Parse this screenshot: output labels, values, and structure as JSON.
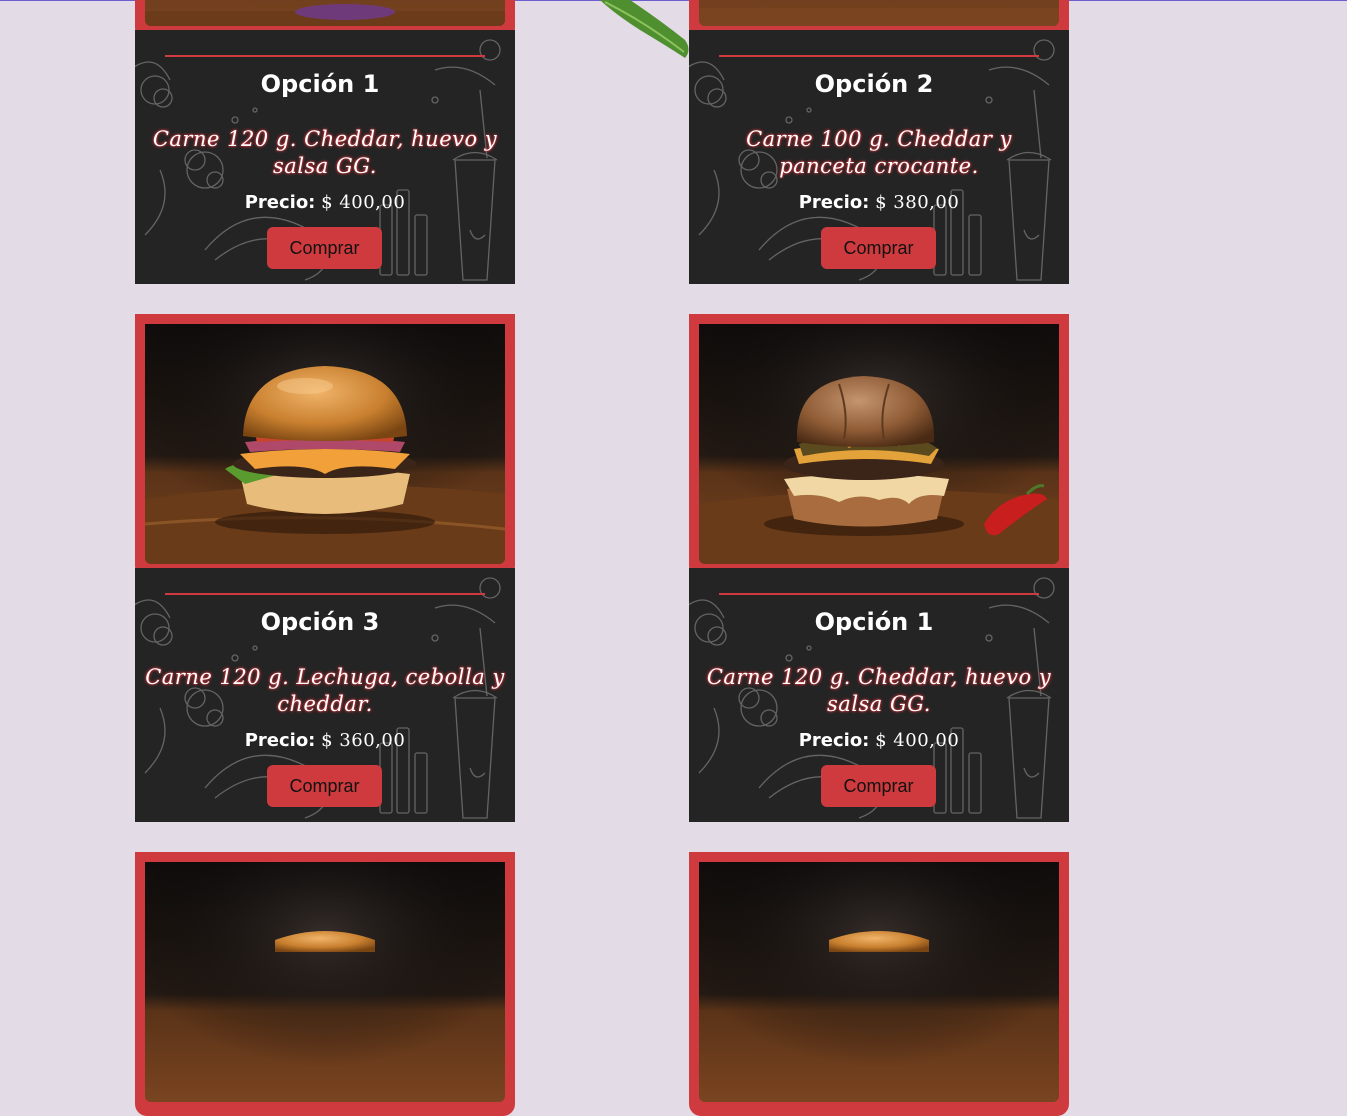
{
  "cards": [
    {
      "title": "Opción 1",
      "description": "Carne 120 g. Cheddar, huevo y salsa GG.",
      "price_label": "Precio:",
      "price_value": "$ 400,00",
      "button": "Comprar"
    },
    {
      "title": "Opción 2",
      "description": "Carne 100 g. Cheddar y panceta crocante.",
      "price_label": "Precio:",
      "price_value": "$ 380,00",
      "button": "Comprar"
    },
    {
      "title": "Opción 3",
      "description": "Carne 120 g. Lechuga, cebolla y cheddar.",
      "price_label": "Precio:",
      "price_value": "$ 360,00",
      "button": "Comprar"
    },
    {
      "title": "Opción 1",
      "description": "Carne 120 g. Cheddar, huevo y salsa GG.",
      "price_label": "Precio:",
      "price_value": "$ 400,00",
      "button": "Comprar"
    },
    {},
    {}
  ],
  "colors": {
    "page_background": "#e3dce7",
    "accent_red": "#cf3a3e",
    "card_dark": "#242424",
    "text_glow": "#e0343c"
  },
  "icons": {
    "burger_photo": "burger-photo",
    "doodle_background": "food-doodles",
    "green_leaf": "leaf-decoration"
  }
}
